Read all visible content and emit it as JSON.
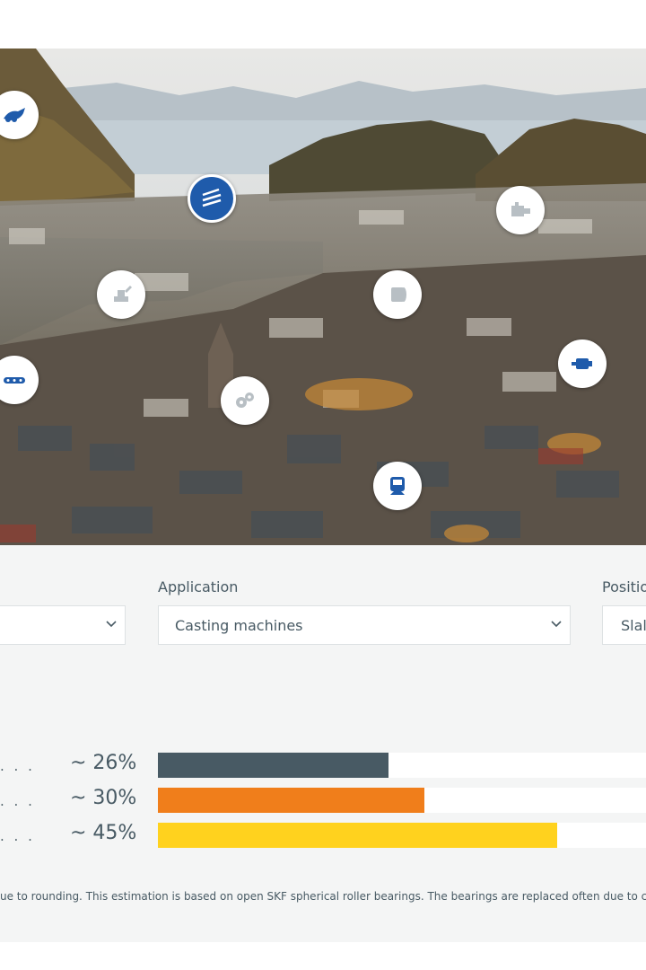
{
  "hero": {
    "pois": [
      {
        "name": "aerospace-icon",
        "active": false
      },
      {
        "name": "steel-pipes-icon",
        "active": true
      },
      {
        "name": "pump-icon",
        "active": false
      },
      {
        "name": "excavator-icon",
        "active": false
      },
      {
        "name": "paper-roll-icon",
        "active": false
      },
      {
        "name": "conveyor-icon",
        "active": false
      },
      {
        "name": "gears-icon",
        "active": false
      },
      {
        "name": "electric-motor-icon",
        "active": false
      },
      {
        "name": "train-icon",
        "active": false
      }
    ]
  },
  "filters": {
    "application_label": "Application",
    "application_value": "Casting machines",
    "position_label": "Positio",
    "position_value": "Slal"
  },
  "results": {
    "dots": ". . .",
    "rows": [
      {
        "pct_label": "~ 26%",
        "value": 26,
        "color": "#485a64"
      },
      {
        "pct_label": "~ 30%",
        "value": 30,
        "color": "#f07e1b"
      },
      {
        "pct_label": "~ 45%",
        "value": 45,
        "color": "#ffd21e"
      }
    ]
  },
  "footnote": "ue to rounding. This estimation is based on open SKF spherical roller bearings. The bearings are replaced often due to corrosio"
}
